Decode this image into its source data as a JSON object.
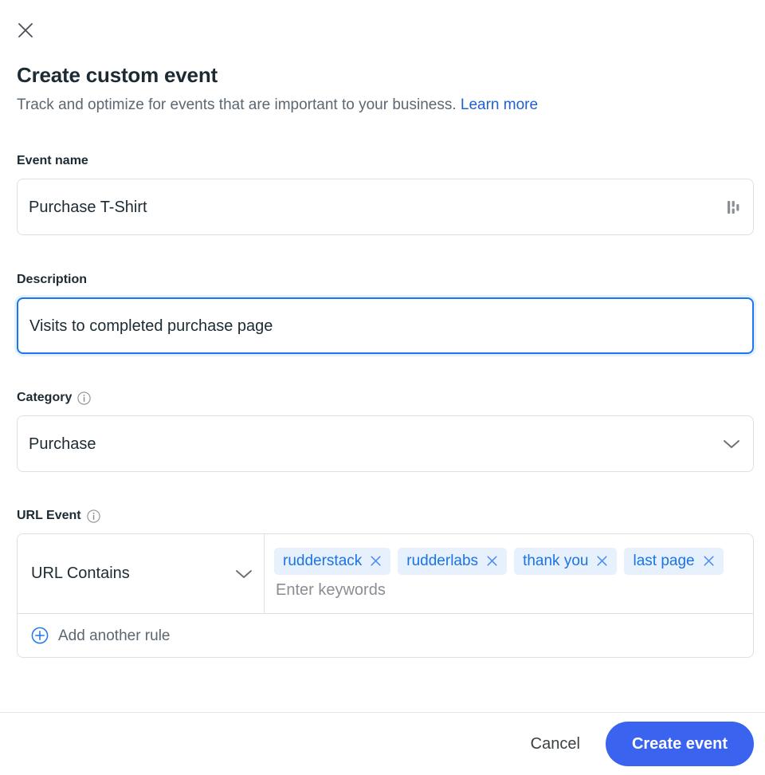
{
  "dialog": {
    "close_icon": "close-icon",
    "title": "Create custom event",
    "subtitle_text": "Track and optimize for events that are important to your business.",
    "subtitle_link": "Learn more"
  },
  "event_name": {
    "label": "Event name",
    "value": "Purchase T-Shirt",
    "placeholder": "Event name",
    "trailing_icon": "bar-chart-icon"
  },
  "description": {
    "label": "Description",
    "value": "Visits to completed purchase page",
    "placeholder": "Description",
    "focused": true
  },
  "category": {
    "label": "Category",
    "info_icon": "info-icon",
    "value": "Purchase",
    "chevron_icon": "chevron-down-icon"
  },
  "url_event": {
    "label": "URL Event",
    "info_icon": "info-icon",
    "operator": "URL Contains",
    "operator_chevron": "chevron-down-icon",
    "keywords": [
      {
        "label": "rudderstack",
        "remove_icon": "close-icon"
      },
      {
        "label": "rudderlabs",
        "remove_icon": "close-icon"
      },
      {
        "label": "thank you",
        "remove_icon": "close-icon"
      },
      {
        "label": "last page",
        "remove_icon": "close-icon"
      }
    ],
    "keywords_placeholder": "Enter keywords",
    "add_rule_label": "Add another rule",
    "add_rule_icon": "plus-circle-icon"
  },
  "footer": {
    "cancel_label": "Cancel",
    "submit_label": "Create event"
  },
  "colors": {
    "accent_blue": "#1877f2",
    "primary_button": "#3a64f0",
    "link_blue": "#2160d3",
    "chip_bg": "#e7f0fd",
    "chip_text": "#1b74e4",
    "text_primary": "#1c2b33",
    "text_secondary": "#5b6771",
    "border": "#dddfe2"
  }
}
